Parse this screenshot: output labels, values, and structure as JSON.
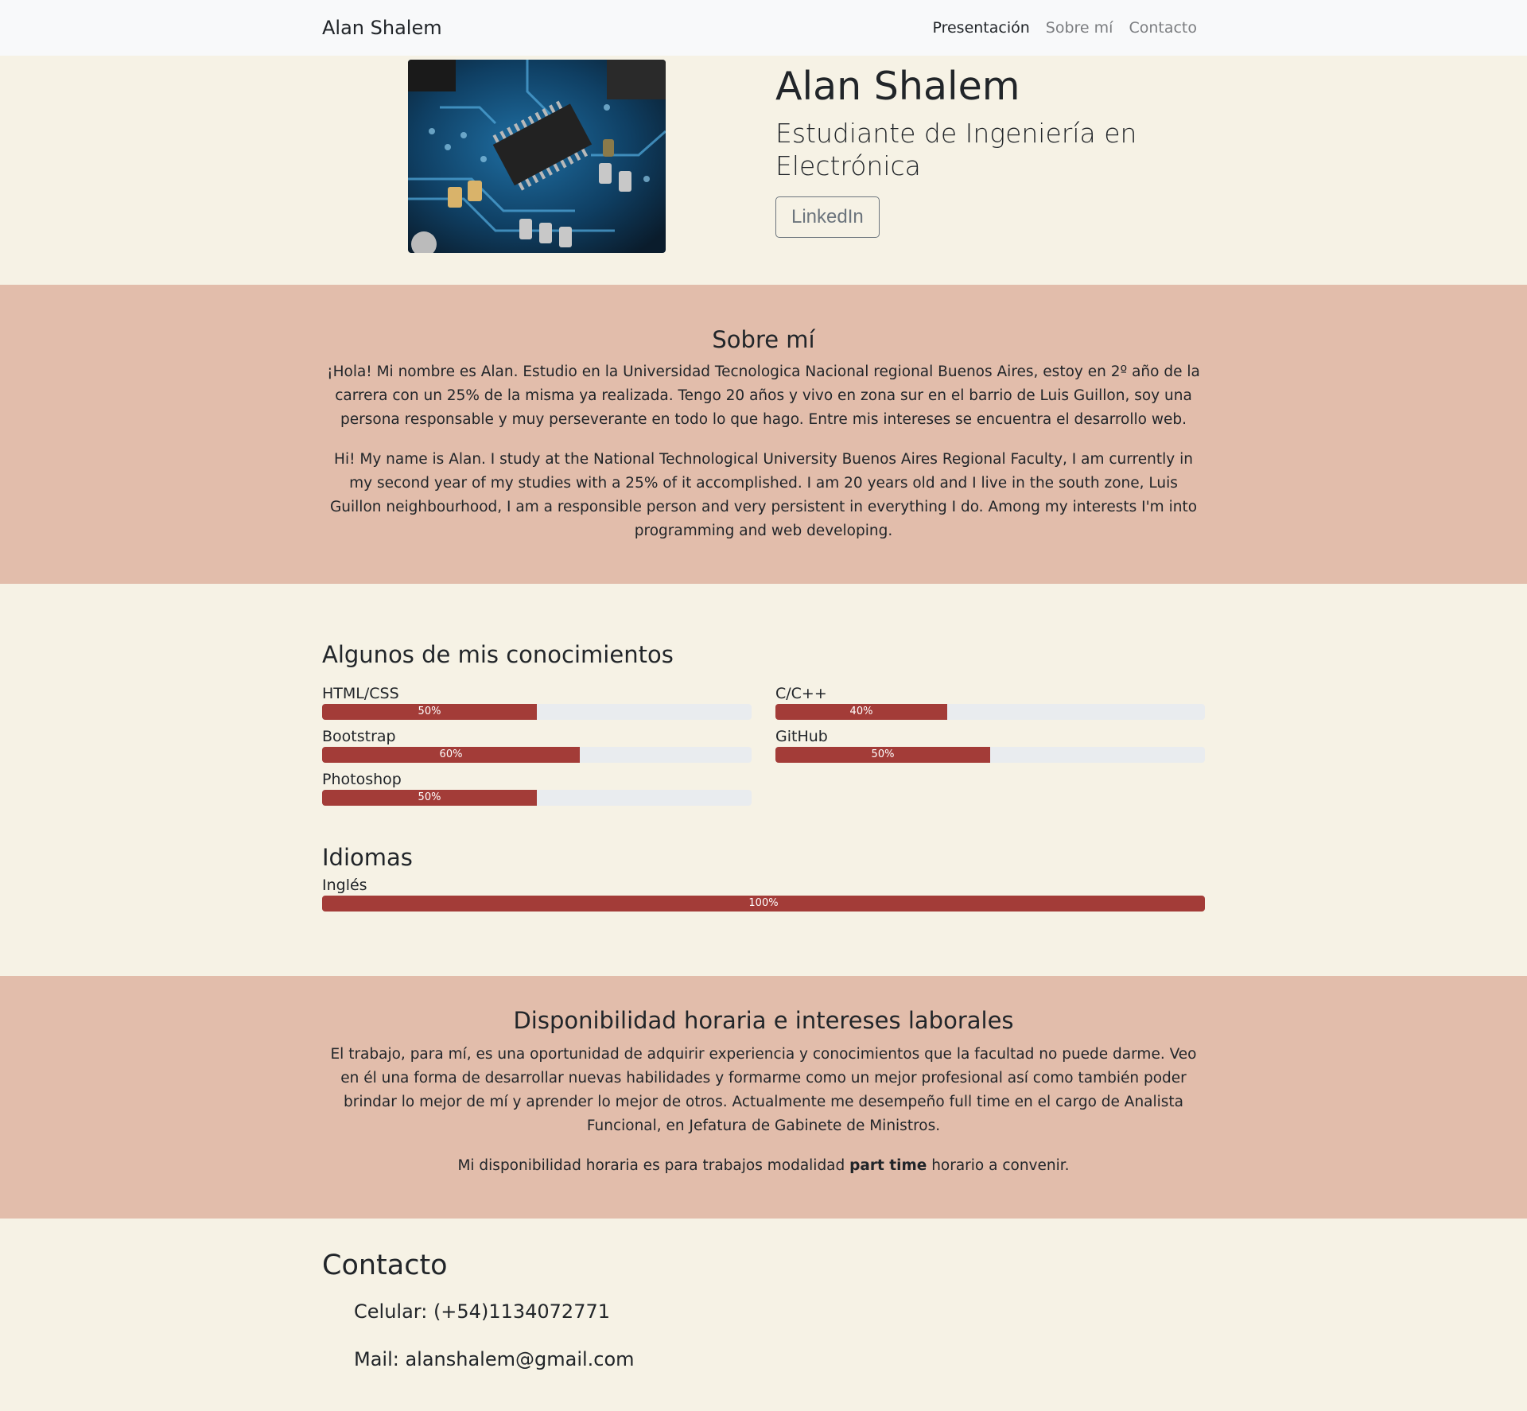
{
  "navbar": {
    "brand": "Alan Shalem",
    "links": [
      "Presentación",
      "Sobre mí",
      "Contacto"
    ]
  },
  "hero": {
    "image_alt": "circuit-board-photo",
    "name": "Alan Shalem",
    "subtitle": "Estudiante de Ingeniería en Electrónica",
    "button_label": "LinkedIn"
  },
  "about": {
    "title": "Sobre mí",
    "paragraph_es": "¡Hola! Mi nombre es Alan. Estudio en la Universidad Tecnologica Nacional regional Buenos Aires, estoy en 2º año de la carrera con un 25% de la misma ya realizada. Tengo 20 años y vivo en zona sur en el barrio de Luis Guillon, soy una persona responsable y muy perseverante en todo lo que hago. Entre mis intereses se encuentra el desarrollo web.",
    "paragraph_en": "Hi! My name is Alan. I study at the National Technological University Buenos Aires Regional Faculty, I am currently in my second year of my studies with a 25% of it accomplished. I am 20 years old and I live in the south zone, Luis Guillon neighbourhood, I am a responsible person and very persistent in everything I do. Among my interests I'm into programming and web developing."
  },
  "skills": {
    "title": "Algunos de mis conocimientos",
    "items": [
      {
        "label": "HTML/CSS",
        "value": 50,
        "text": "50%"
      },
      {
        "label": "C/C++",
        "value": 40,
        "text": "40%"
      },
      {
        "label": "Bootstrap",
        "value": 60,
        "text": "60%"
      },
      {
        "label": "GitHub",
        "value": 50,
        "text": "50%"
      },
      {
        "label": "Photoshop",
        "value": 50,
        "text": "50%"
      }
    ]
  },
  "languages": {
    "title": "Idiomas",
    "items": [
      {
        "label": "Inglés",
        "value": 100,
        "text": "100%"
      }
    ]
  },
  "work": {
    "title": "Disponibilidad horaria e intereses laborales",
    "paragraph": "El trabajo, para mí, es una oportunidad de adquirir experiencia y conocimientos que la facultad no puede darme. Veo en él una forma de desarrollar nuevas habilidades y formarme como un mejor profesional así como también poder brindar lo mejor de mí y aprender lo mejor de otros. Actualmente me desempeño full time en el cargo de Analista Funcional, en Jefatura de Gabinete de Ministros.",
    "availability_before": "Mi disponibilidad horaria es para trabajos modalidad ",
    "availability_strong": "part time",
    "availability_after": " horario a convenir."
  },
  "contact": {
    "title": "Contacto",
    "phone": "Celular: (+54)1134072771",
    "mail": "Mail: alanshalem@gmail.com"
  },
  "colors": {
    "bar_fill": "#a33c38",
    "band": "#e2bdab",
    "page_bg": "#f6f2e5"
  }
}
